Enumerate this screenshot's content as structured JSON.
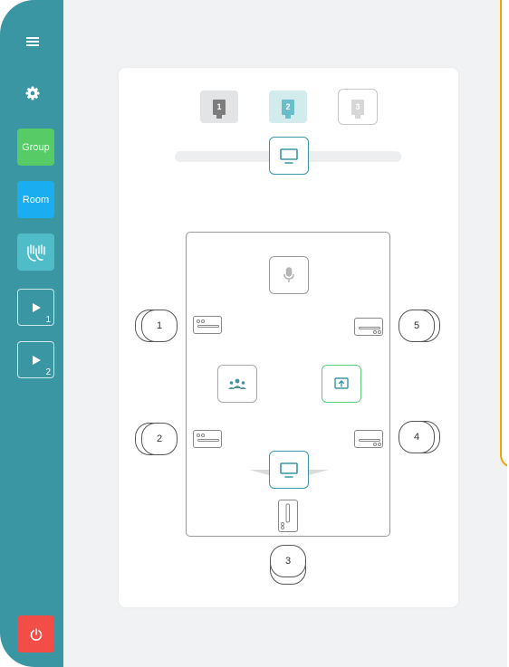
{
  "sidebar": {
    "group_label": "Group",
    "room_label": "Room",
    "play1_sub": "1",
    "play2_sub": "2",
    "icons": [
      "menu-icon",
      "gear-icon",
      "raised-hands-icon",
      "play-icon",
      "play-icon",
      "power-icon"
    ]
  },
  "monitors": [
    {
      "label": "1",
      "color": "#7d7d7d"
    },
    {
      "label": "2",
      "color": "#69bec9"
    },
    {
      "label": "3",
      "color": "#d7d7d7"
    }
  ],
  "seats": {
    "s1": "1",
    "s2": "2",
    "s3": "3",
    "s4": "4",
    "s5": "5"
  },
  "colors": {
    "sidebar": "#3a96a3",
    "group": "#57cc66",
    "room": "#1aaef0",
    "hands": "#4fbcc8",
    "power": "#f24d47",
    "accent_orange": "#f5a400",
    "share_green": "#5fcc7a"
  }
}
